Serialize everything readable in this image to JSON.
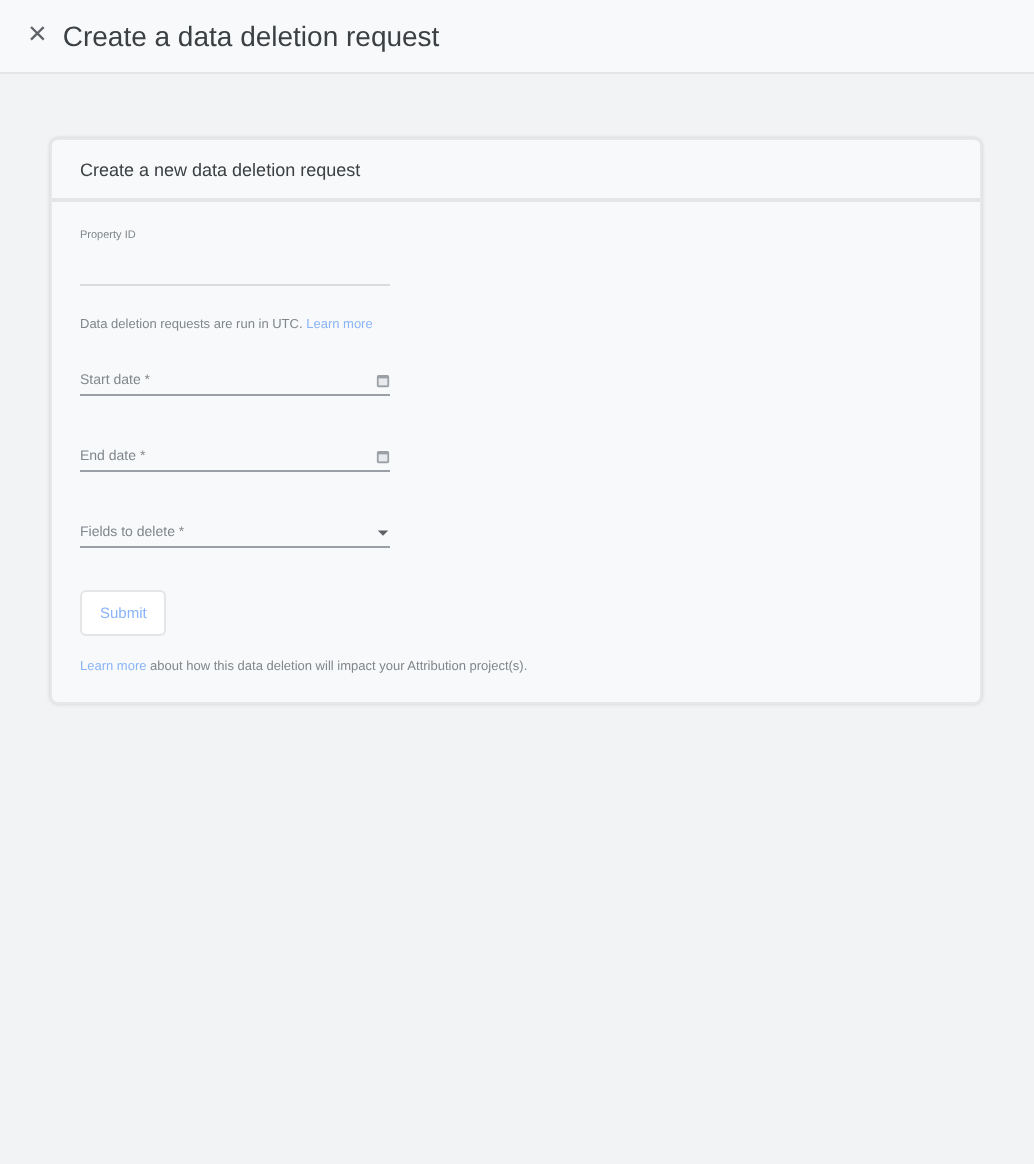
{
  "header": {
    "close_icon": "×",
    "title": "Create a data deletion request"
  },
  "card": {
    "title": "Create a new data deletion request",
    "fields": [
      {
        "kind": "text",
        "label": "Property ID"
      },
      {
        "kind": "note",
        "text": "Data deletion requests are run in UTC. ",
        "link": "Learn more"
      },
      {
        "kind": "date",
        "label": "Start date *"
      },
      {
        "kind": "date",
        "label": "End date *"
      },
      {
        "kind": "select",
        "label": "Fields to delete *"
      }
    ],
    "submit": {
      "label": "Submit",
      "disabled": true
    },
    "footer": {
      "link": "Learn more",
      "text": " about how this data deletion will impact your Attribution project(s)."
    }
  }
}
